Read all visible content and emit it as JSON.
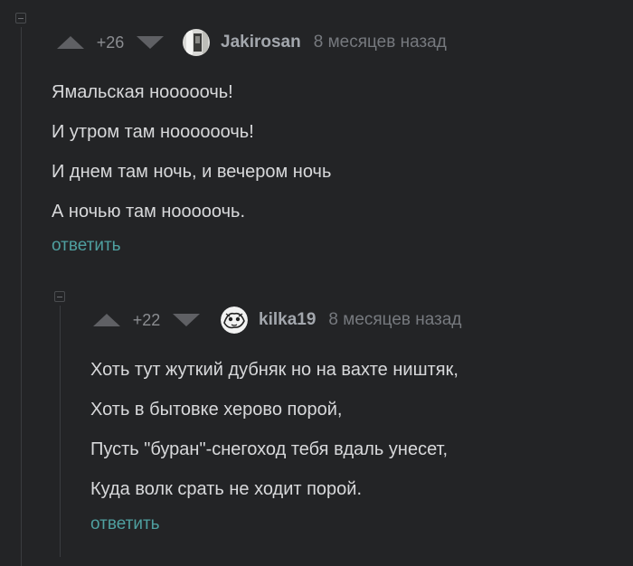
{
  "comments": [
    {
      "rating": "+26",
      "username": "Jakirosan",
      "timestamp": "8 месяцев назад",
      "lines": [
        "Ямальская нооооочь!",
        "И утром там ноооооочь!",
        "И днем там ночь, и вечером ночь",
        "А ночью там нооооочь."
      ],
      "reply_label": "ответить"
    },
    {
      "rating": "+22",
      "username": "kilka19",
      "timestamp": "8 месяцев назад",
      "lines": [
        "Хоть тут жуткий дубняк но на вахте ништяк,",
        "Хоть в бытовке херово порой,",
        "Пусть \"буран\"-снегоход тебя вдаль унесет,",
        "Куда волк срать не ходит порой."
      ],
      "reply_label": "ответить"
    }
  ],
  "colors": {
    "background": "#232426",
    "vote_up": "#5f6064",
    "vote_down": "#5f6064",
    "reply_link": "#4fa0a0",
    "username": "#a3a7ad"
  },
  "icons": {
    "collapse": "collapse-minus-icon",
    "up": "arrow-up-icon",
    "down": "arrow-down-icon"
  }
}
